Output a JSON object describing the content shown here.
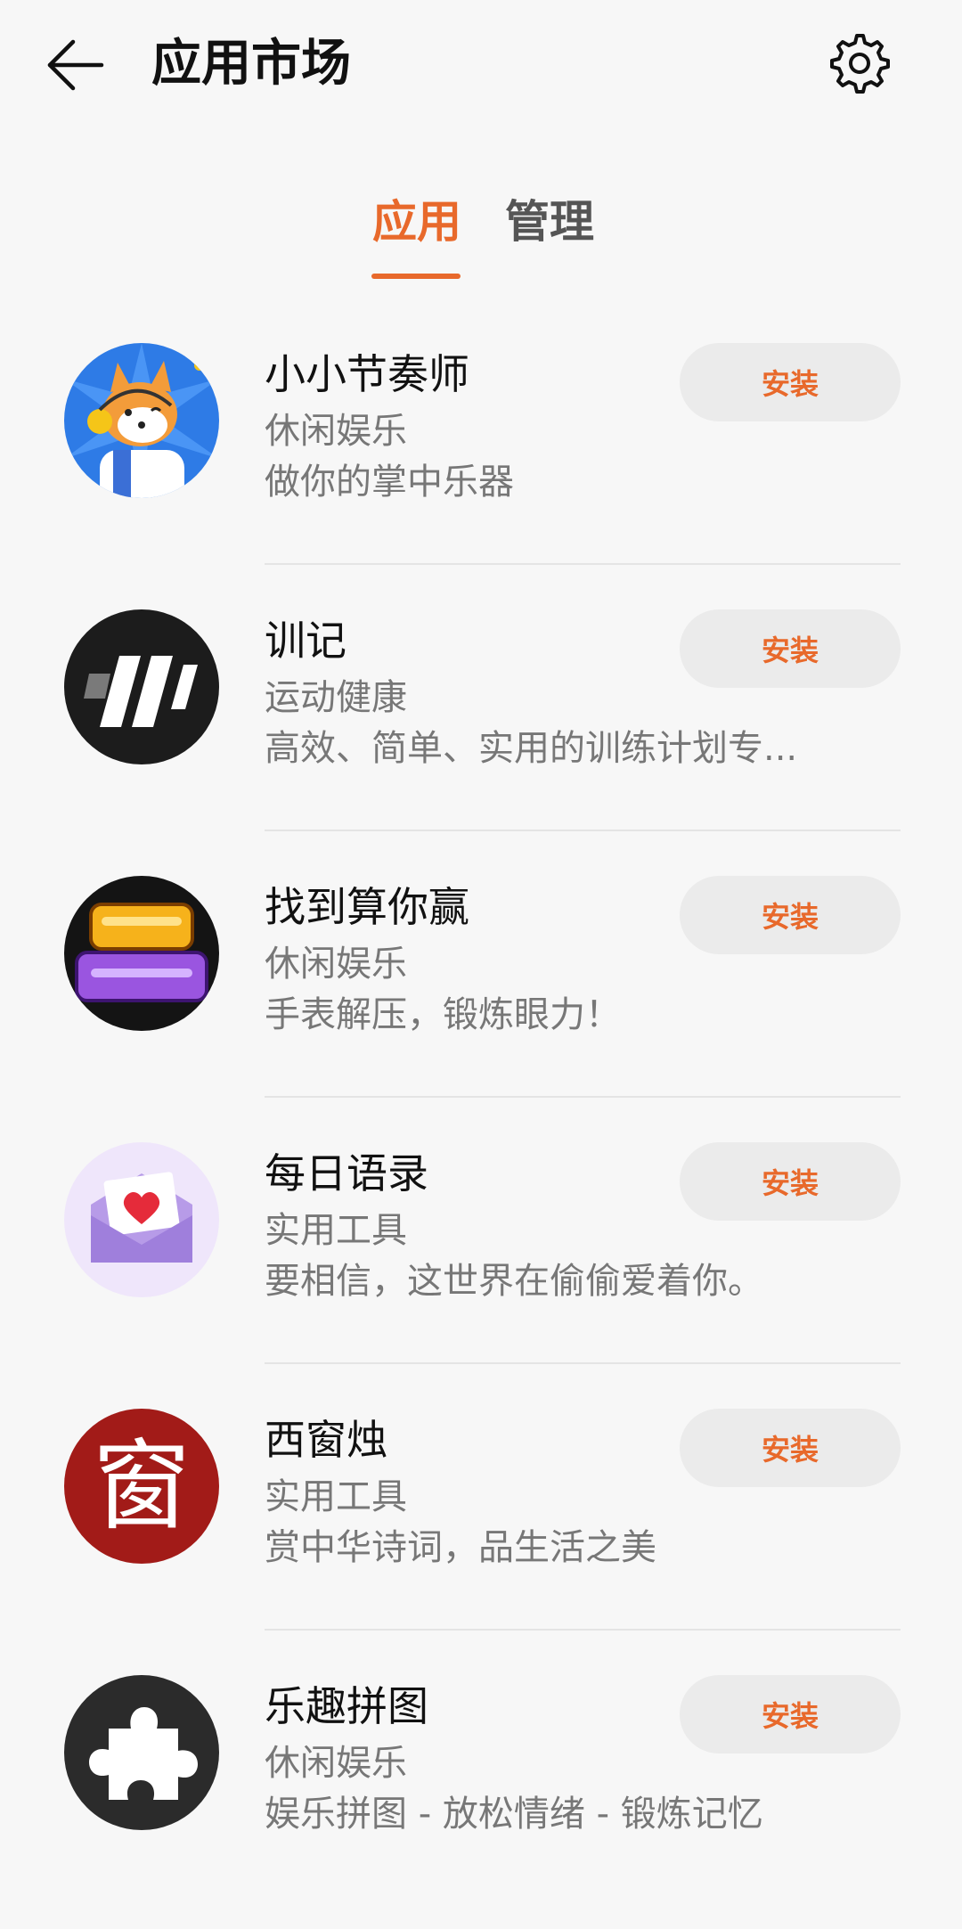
{
  "header": {
    "title": "应用市场",
    "back_icon": "arrow-left-icon",
    "settings_icon": "gear-icon"
  },
  "tabs": [
    {
      "label": "应用",
      "active": true
    },
    {
      "label": "管理",
      "active": false
    }
  ],
  "accent_color": "#e8692b",
  "apps": [
    {
      "name": "小小节奏师",
      "category": "休闲娱乐",
      "description": "做你的掌中乐器",
      "button": "安装",
      "icon": "shiba-musician-icon"
    },
    {
      "name": "训记",
      "category": "运动健康",
      "description": "高效、简单、实用的训练计划专...",
      "button": "安装",
      "icon": "stripes-logo-icon"
    },
    {
      "name": "找到算你赢",
      "category": "休闲娱乐",
      "description": "手表解压，锻炼眼力！",
      "button": "安装",
      "icon": "game-title-icon"
    },
    {
      "name": "每日语录",
      "category": "实用工具",
      "description": "要相信，这世界在偷偷爱着你。",
      "button": "安装",
      "icon": "heart-envelope-icon"
    },
    {
      "name": "西窗烛",
      "category": "实用工具",
      "description": "赏中华诗词，品生活之美",
      "button": "安装",
      "icon": "chinese-character-icon",
      "icon_text": "窗"
    },
    {
      "name": "乐趣拼图",
      "category": "休闲娱乐",
      "description": "娱乐拼图 - 放松情绪 - 锻炼记忆",
      "button": "安装",
      "icon": "puzzle-piece-icon"
    }
  ]
}
